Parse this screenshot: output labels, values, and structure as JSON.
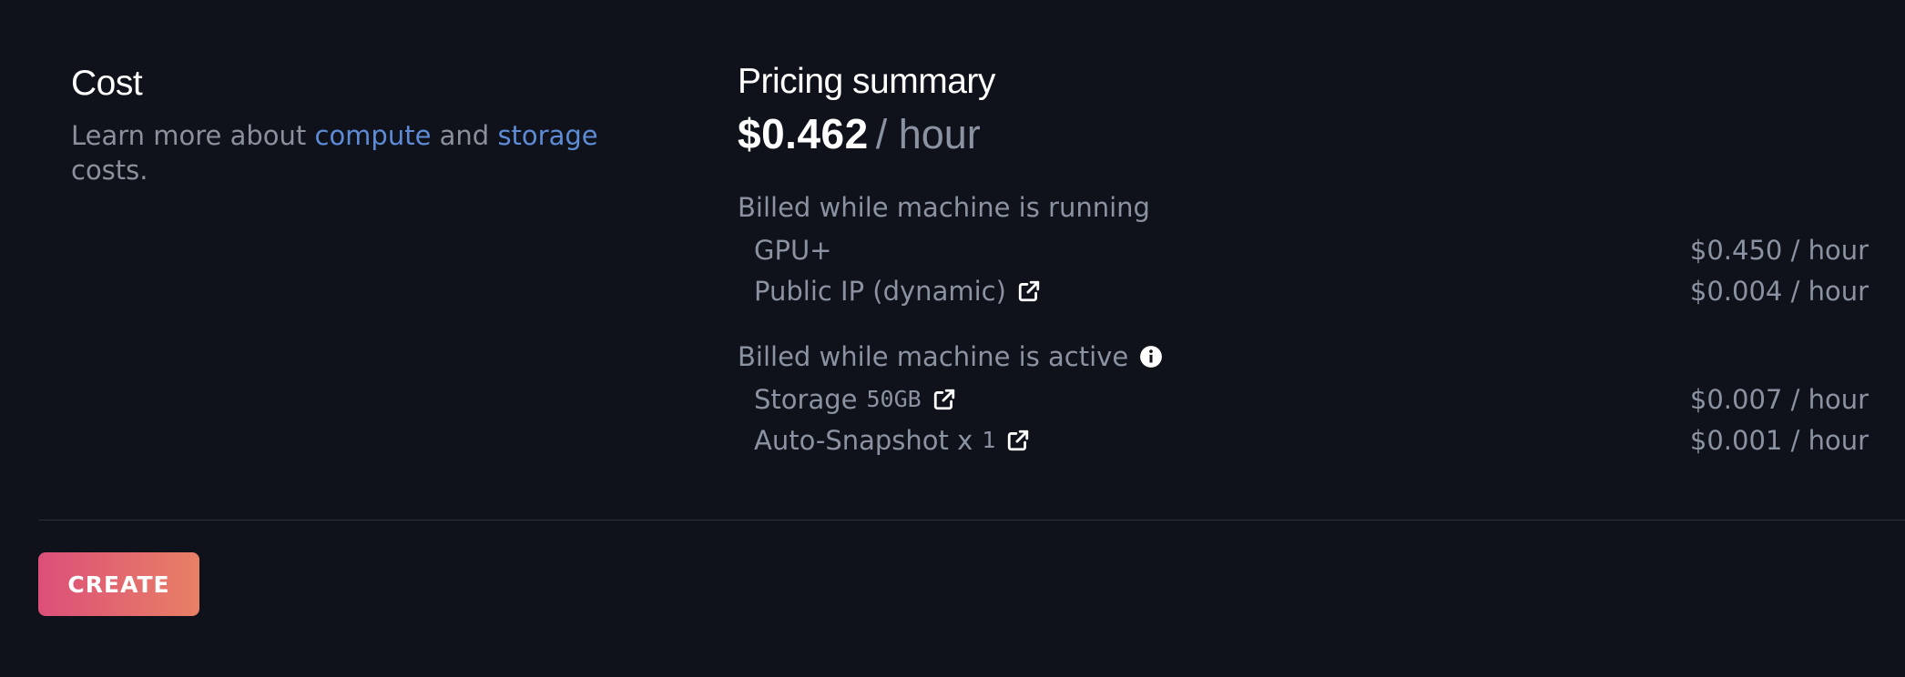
{
  "cost": {
    "title": "Cost",
    "desc_prefix": "Learn more about ",
    "compute_link": "compute",
    "and_text": " and ",
    "storage_link": "storage",
    "desc_suffix": " costs."
  },
  "pricing": {
    "title": "Pricing summary",
    "total_amount": "$0.462",
    "total_unit": "/ hour",
    "groups": [
      {
        "heading": "Billed while machine is running",
        "items": [
          {
            "label": "GPU+",
            "price": "$0.450 / hour"
          },
          {
            "label": "Public IP (dynamic)",
            "price": "$0.004 / hour"
          }
        ]
      },
      {
        "heading": "Billed while machine is active",
        "items": [
          {
            "label": "Storage",
            "detail": "50GB",
            "price": "$0.007 / hour"
          },
          {
            "label": "Auto-Snapshot x",
            "detail": "1",
            "price": "$0.001 / hour"
          }
        ]
      }
    ]
  },
  "actions": {
    "create_label": "CREATE"
  },
  "icons": {
    "external_link": "external-link-icon",
    "info": "info-icon"
  },
  "colors": {
    "background": "#0f121a",
    "link": "#5d8bd6",
    "button_gradient_start": "#dc4f79",
    "button_gradient_end": "#e88065"
  }
}
